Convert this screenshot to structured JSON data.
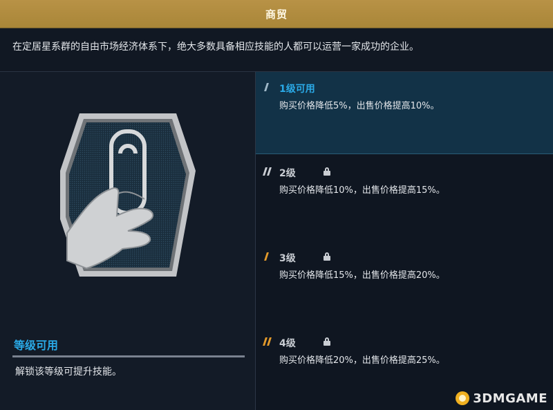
{
  "header": {
    "title": "商贸"
  },
  "description": "在定居星系群的自由市场经济体系下，绝大多数具备相应技能的人都可以运营一家成功的企业。",
  "left_panel": {
    "emblem_icon": "hand-holding-card-icon",
    "status_title": "等级可用",
    "status_desc": "解锁该等级可提升技能。"
  },
  "levels": [
    {
      "name": "1级可用",
      "desc": "购买价格降低5%，出售价格提高10%。",
      "locked": false,
      "active": true
    },
    {
      "name": "2级",
      "desc": "购买价格降低10%，出售价格提高15%。",
      "locked": true,
      "active": false
    },
    {
      "name": "3级",
      "desc": "购买价格降低15%，出售价格提高20%。",
      "locked": true,
      "active": false
    },
    {
      "name": "4级",
      "desc": "购买价格降低20%，出售价格提高25%。",
      "locked": true,
      "active": false
    }
  ],
  "colors": {
    "gold": "#b89246",
    "accent_blue": "#2aa9e6",
    "tick_active": "#9fb8c8",
    "tick_orange": "#e39a2b",
    "tick_grey": "#c9cdd3"
  },
  "watermark": "3DMGAME"
}
